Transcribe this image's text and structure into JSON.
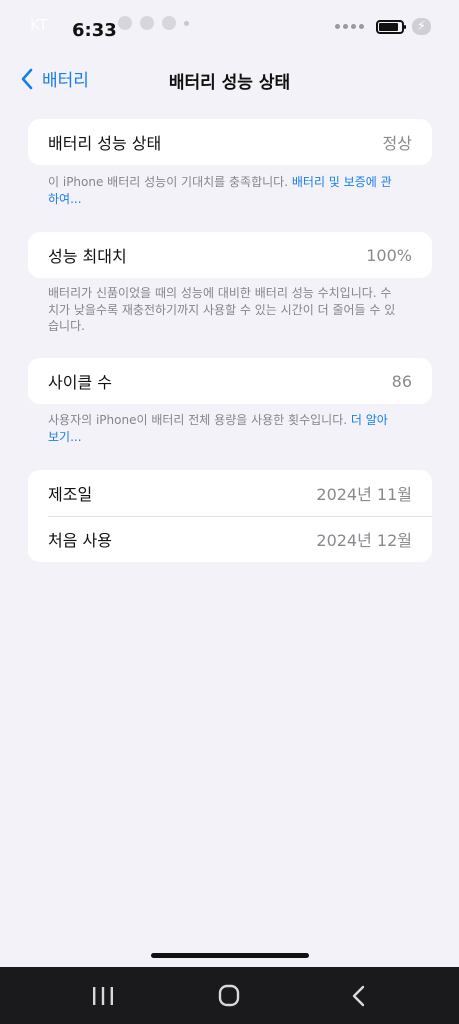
{
  "status_bar": {
    "carrier": "KT",
    "time": "6:33"
  },
  "nav": {
    "back_label": "배터리",
    "title": "배터리 성능 상태"
  },
  "battery_health": {
    "label": "배터리 성능 상태",
    "value": "정상",
    "note_text": "이 iPhone 배터리 성능이 기대치를 충족합니다. ",
    "note_link": "배터리 및 보증에 관하여..."
  },
  "max_capacity": {
    "label": "성능 최대치",
    "value": "100%",
    "note_text": "배터리가 신품이었을 때의 성능에 대비한 배터리 성능 수치입니다. 수치가 낮을수록 재충전하기까지 사용할 수 있는 시간이 더 줄어들 수 있습니다."
  },
  "cycle_count": {
    "label": "사이클 수",
    "value": "86",
    "note_text": "사용자의 iPhone이 배터리 전체 용량을 사용한 횟수입니다. ",
    "note_link": "더 알아보기..."
  },
  "dates": {
    "manufacture_label": "제조일",
    "manufacture_value": "2024년 11월",
    "first_use_label": "처음 사용",
    "first_use_value": "2024년 12월"
  },
  "icons": {
    "back": "chevron-left-icon",
    "recents": "recents-icon",
    "home": "home-icon",
    "android_back": "back-nav-icon"
  },
  "colors": {
    "accent": "#1a7ee8",
    "background": "#f3f2f8",
    "card": "#ffffff",
    "secondary_text": "#8a898f"
  }
}
